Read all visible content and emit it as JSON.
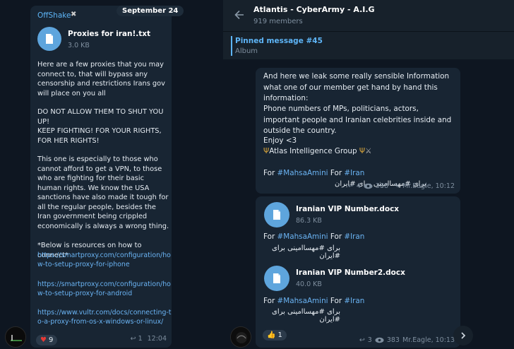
{
  "left": {
    "date": "September 24",
    "sender": "OffShake",
    "sender_badge": "✖",
    "file_name": "Proxies for iran!.txt",
    "file_size": "3.0 KB",
    "para1": "Here are a few proxies that you may connect to, that will bypass any censorship and restrictions Irans gov will place on you all",
    "para2": "DO NOT ALLOW THEM TO SHUT YOU UP!",
    "para3": "KEEP FIGHTING! FOR YOUR RIGHTS, FOR HER RIGHTS!",
    "para4": "This one is especially to those who cannot afford to get a VPN, to those who are fighting for their basic human rights. We know the USA sanctions have also made it tough for all the regular people, besides the Iran government being crippled economically is always a wrong thing.",
    "para5": "*Below is resources on how to connect*",
    "link1": "https://smartproxy.com/configuration/how-to-setup-proxy-for-iphone",
    "link2": "https://smartproxy.com/configuration/how-to-setup-proxy-for-android",
    "link3": "https://www.vultr.com/docs/connecting-to-a-proxy-from-os-x-windows-or-linux/",
    "reaction_emoji": "♥",
    "reaction_count": "9",
    "replies": "1",
    "time": "12:04"
  },
  "header": {
    "title": "Atlantis - CyberArmy - A.I.G",
    "members": "919 members"
  },
  "pinned": {
    "title": "Pinned message #45",
    "subtitle": "Album"
  },
  "msg1": {
    "line1": "And here we leak some really sensible Information what one of our member get hand by hand this information:",
    "line2": "Phone numbers of MPs, politicians, actors, important people and Iranian celebrities inside and outside the country.",
    "enjoy": "Enjoy <3",
    "signature": "Atlas Intelligence Group",
    "for1": "For ",
    "tag1": "#MahsaAmini",
    "for2": " For ",
    "tag2": "#Iran",
    "rtl_text": "برای #مهساامینی برای #ایران",
    "replies": "4",
    "views": "388",
    "author": "Mr.Eagle, 10:12"
  },
  "msg2": {
    "file1_name": "Iranian VIP Number.docx",
    "file1_size": "86.3 KB",
    "file2_name": "Iranian VIP Number2.docx",
    "file2_size": "40.0 KB",
    "for1": "For ",
    "tag1": "#MahsaAmini",
    "for2": " For ",
    "tag2": "#Iran",
    "rtl_text": "برای #مهساامینی برای #ایران",
    "reaction_emoji": "👍",
    "reaction_count": "1",
    "replies": "3",
    "views": "383",
    "author": "Mr.Eagle, 10:13"
  },
  "colors": {
    "accent": "#5eb5f7",
    "link": "#6ab3f3",
    "bubble": "#182533",
    "background": "#0e1621"
  },
  "icons": {
    "back": "arrow-left-icon",
    "file": "file-icon",
    "reply": "reply-icon",
    "views": "eye-icon",
    "pin": "pin-icon",
    "scroll": "chevron-right-icon"
  }
}
